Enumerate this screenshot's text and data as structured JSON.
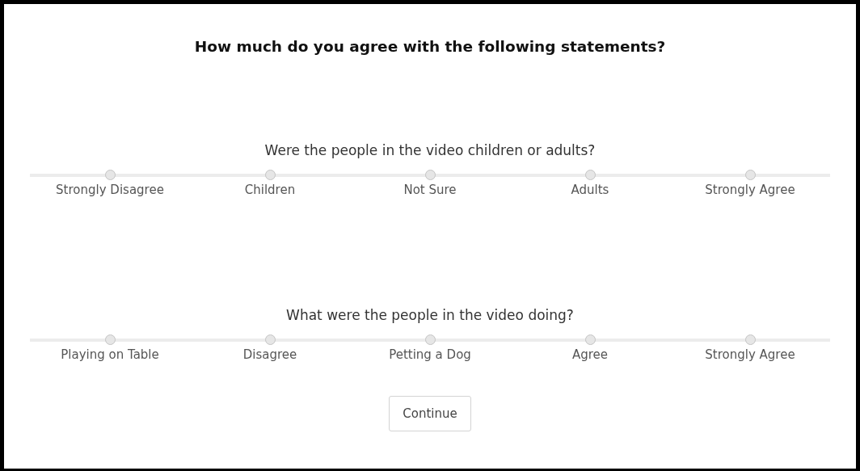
{
  "title": "How much do you agree with the following statements?",
  "questions": [
    {
      "prompt": "Were the people in the video children or adults?",
      "options": [
        {
          "label": "Strongly Disagree",
          "selected": false
        },
        {
          "label": "Children",
          "selected": false
        },
        {
          "label": "Not Sure",
          "selected": false
        },
        {
          "label": "Adults",
          "selected": false
        },
        {
          "label": "Strongly Agree",
          "selected": false
        }
      ]
    },
    {
      "prompt": "What were the people in the video doing?",
      "options": [
        {
          "label": "Playing on Table",
          "selected": false
        },
        {
          "label": "Disagree",
          "selected": false
        },
        {
          "label": "Petting a Dog",
          "selected": false
        },
        {
          "label": "Agree",
          "selected": false
        },
        {
          "label": "Strongly Agree",
          "selected": false
        }
      ]
    }
  ],
  "button": "Continue"
}
